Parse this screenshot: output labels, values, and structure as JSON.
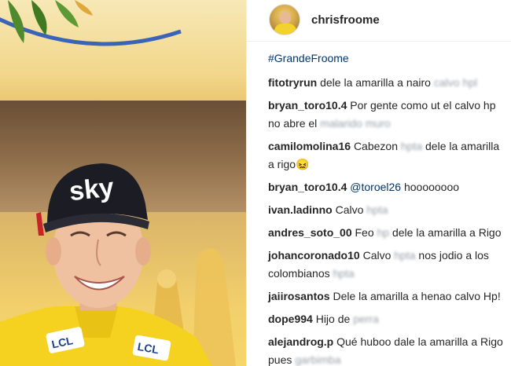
{
  "post": {
    "username": "chrisfroome",
    "avatar_icon": "profile-avatar",
    "hashtag": "#GrandeFroome"
  },
  "comments": [
    {
      "user": "fitotryrun",
      "text": "dele la amarilla a nairo",
      "blurred": "calvo hpl"
    },
    {
      "user": "bryan_toro10.4",
      "text": "Por gente como ut el calvo hp no abre el",
      "blurred": "malarido muro"
    },
    {
      "user": "camilomolina16",
      "text": "Cabezon",
      "blurred": "hpta",
      "text2": "dele la amarilla a rigo",
      "emoji": "😖"
    },
    {
      "user": "bryan_toro10.4",
      "mention": "@toroel26",
      "text": "hoooooooo"
    },
    {
      "user": "ivan.ladinno",
      "text": "Calvo",
      "blurred": "hpta"
    },
    {
      "user": "andres_soto_00",
      "text": "Feo",
      "blurred": "hp",
      "text2": "dele la amarilla a Rigo"
    },
    {
      "user": "johancoronado10",
      "text": "Calvo",
      "blurred": "hpta",
      "text2": "nos jodio a los colombianos",
      "blurred2": "hpta"
    },
    {
      "user": "jaiirosantos",
      "text": "Dele la amarilla a henao calvo Hp!"
    },
    {
      "user": "dope994",
      "text": "Hijo de",
      "blurred": "perra"
    },
    {
      "user": "alejandrog.p",
      "text": "Qué huboo dale la amarilla a Rigo pues",
      "blurred": "garbimba"
    }
  ],
  "photo": {
    "cap_logo": "sky",
    "jersey_logo": "LCL",
    "jersey_color": "#f5d21f",
    "cap_color": "#1b1c24"
  },
  "colors": {
    "link": "#003569",
    "text": "#262626",
    "blurred": "#9aa0a8"
  }
}
